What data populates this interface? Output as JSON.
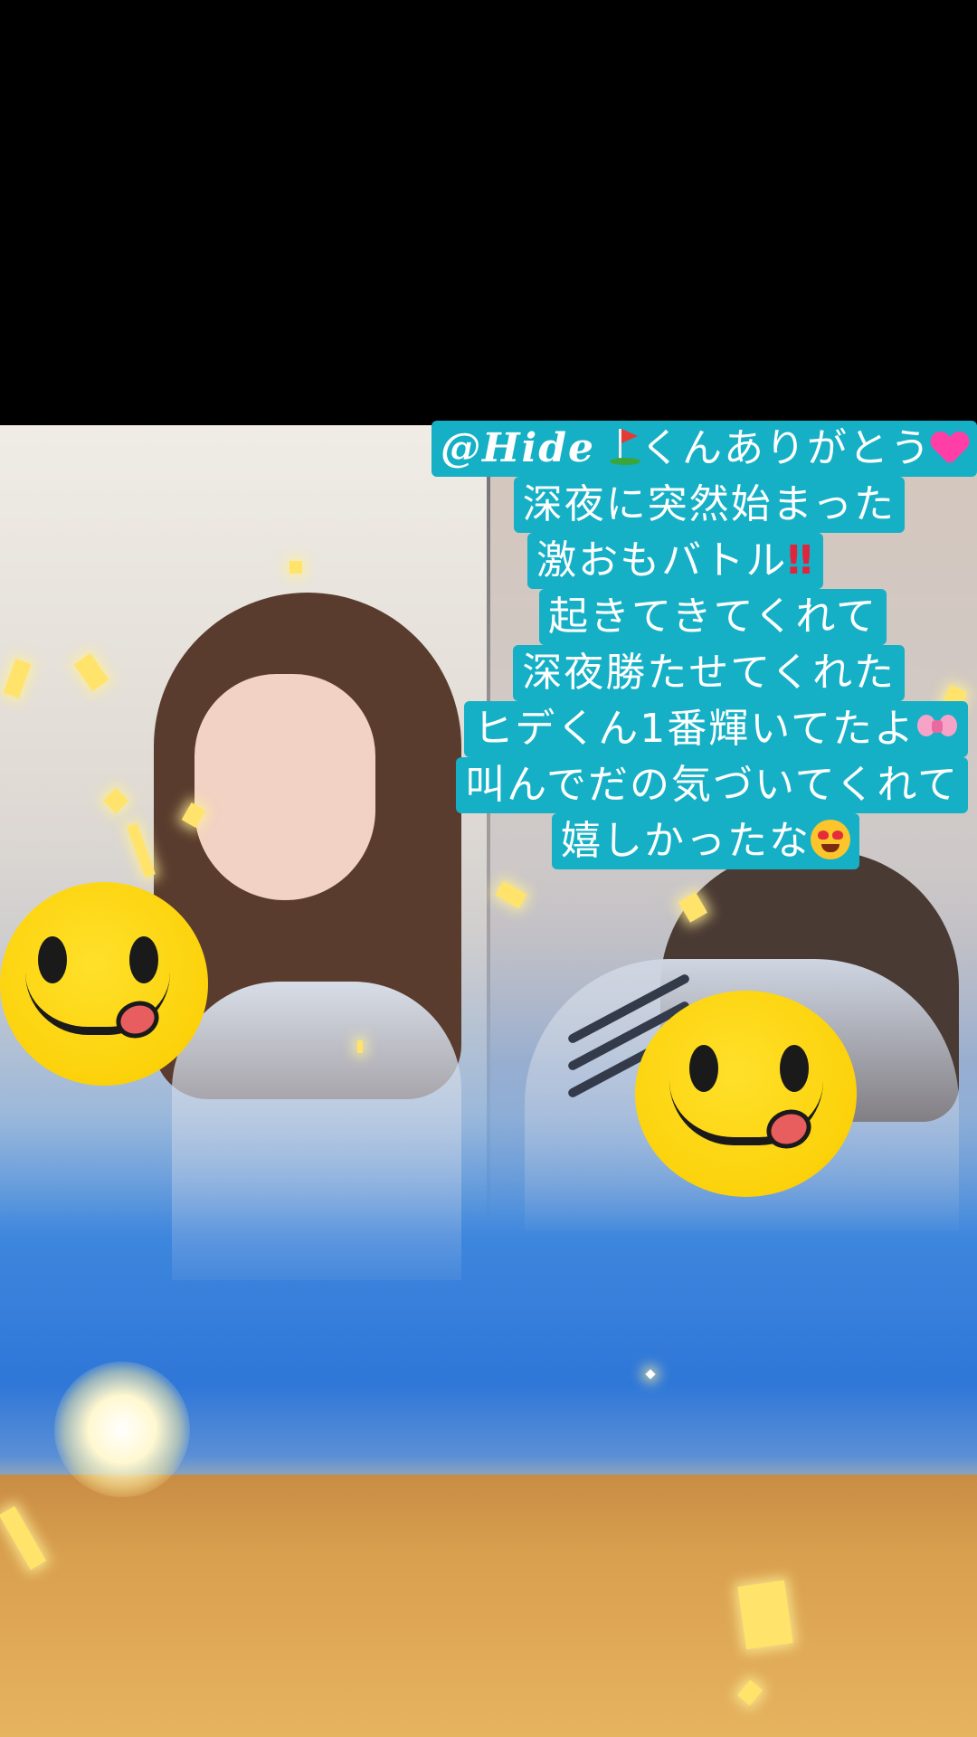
{
  "caption": {
    "lines": [
      {
        "handle": "@Hide",
        "text": "くんありがとう",
        "prefix_icon": "golf-flag-icon",
        "suffix_icon": "pink-heart-icon"
      },
      {
        "text": "深夜に突然始まった"
      },
      {
        "text": "激おもバトル",
        "suffix_icon": "double-exclamation-icon",
        "suffix_text": "‼"
      },
      {
        "text": "起きてきてくれて"
      },
      {
        "text": "深夜勝たせてくれた"
      },
      {
        "text": "ヒデくん1番輝いてたよ",
        "suffix_icon": "ribbon-icon"
      },
      {
        "text": "叫んでだの気づいてくれて"
      },
      {
        "text": "嬉しかったな",
        "suffix_icon": "heart-eyes-emoji-icon"
      }
    ],
    "background_color": "#15b0c6",
    "text_color": "#ffffff"
  },
  "stickers": [
    {
      "name": "smiley-sticker-left",
      "icon": "yum-face-icon"
    },
    {
      "name": "smiley-sticker-right",
      "icon": "yum-face-icon"
    }
  ],
  "colors": {
    "letterbox": "#000000",
    "sky": "#2f77d8",
    "sand": "#d9a04f",
    "sticker_yellow": "#fcd20b"
  }
}
